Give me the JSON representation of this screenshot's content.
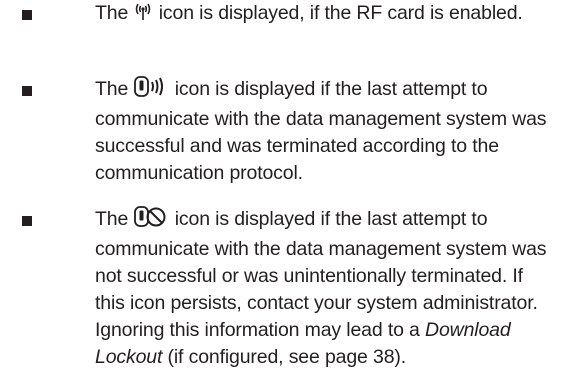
{
  "items": [
    {
      "icon": "rf-antenna-icon",
      "before": "The",
      "after": "icon is displayed, if the RF card is enabled."
    },
    {
      "icon": "communication-success-icon",
      "before": "The",
      "after": "icon is displayed if the last attempt to communicate with the data management system was successful and was terminated according to the communication protocol."
    },
    {
      "icon": "communication-failed-icon",
      "before": "The",
      "after_1": "icon is displayed if the last attempt to communicate with the data management system was not successful or was unintentionally terminated. If this icon persists, contact your system administrator. Ignoring this information may lead to a",
      "italic": "Download Lockout",
      "after_2": "(if configured, see page 38)."
    }
  ]
}
